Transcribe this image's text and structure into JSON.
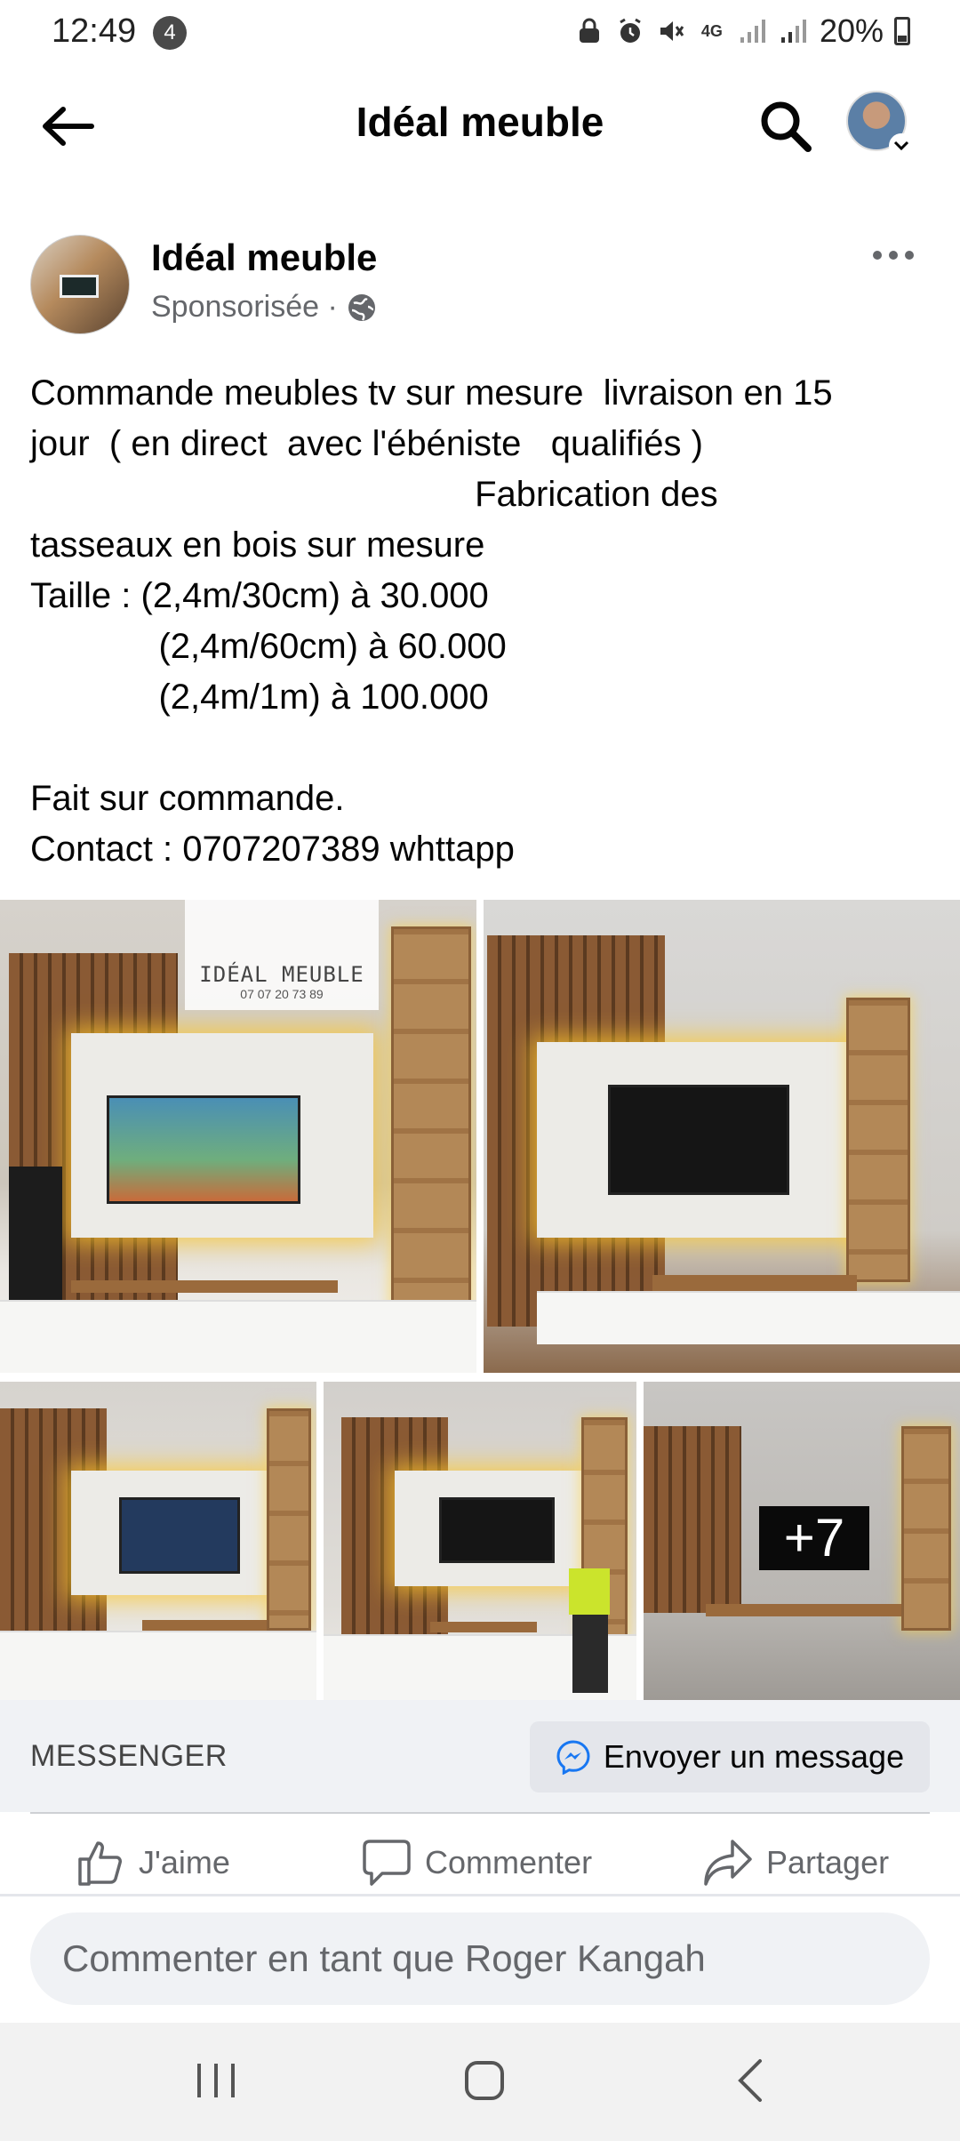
{
  "status_bar": {
    "time": "12:49",
    "notification_count": "4",
    "network": "4G",
    "battery": "20%"
  },
  "header": {
    "title": "Idéal meuble"
  },
  "post": {
    "page_name": "Idéal meuble",
    "sponsored": "Sponsorisée ·",
    "text": "Commande meubles tv sur mesure  livraison en 15\njour  ( en direct  avec l'ébéniste   qualifiés )\n                                             Fabrication des\ntasseaux en bois sur mesure\nTaille : (2,4m/30cm) à 30.000\n             (2,4m/60cm) à 60.000\n             (2,4m/1m) à 100.000\n\nFait sur commande.\nContact : 0707207389 whttapp",
    "image_logo_title": "IDÉAL MEUBLE",
    "image_logo_phone": "07 07 20 73 89",
    "more_images": "+7"
  },
  "messenger": {
    "label": "MESSENGER",
    "button": "Envoyer un message"
  },
  "actions": {
    "like": "J'aime",
    "comment": "Commenter",
    "share": "Partager"
  },
  "comment_box": {
    "placeholder": "Commenter en tant que Roger Kangah"
  },
  "colors": {
    "accent": "#1877f2",
    "secondary_text": "#65676b",
    "bar_bg": "#f0f2f5"
  },
  "icons": [
    "back-arrow-icon",
    "search-icon",
    "more-dots-icon",
    "globe-icon",
    "messenger-icon",
    "like-icon",
    "comment-icon",
    "share-icon",
    "recents-icon",
    "home-icon",
    "back-nav-icon"
  ]
}
